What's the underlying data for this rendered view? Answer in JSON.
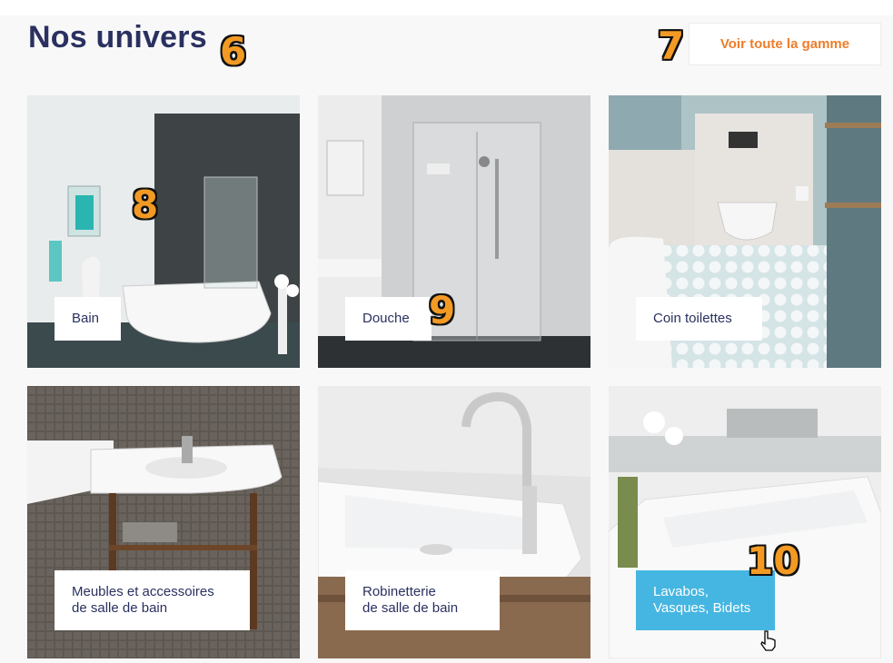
{
  "section": {
    "title": "Nos univers",
    "see_all_label": "Voir toute la gamme"
  },
  "markers": [
    "6",
    "7",
    "8",
    "9",
    "10"
  ],
  "tiles": [
    {
      "label": "Bain"
    },
    {
      "label": "Douche"
    },
    {
      "label": "Coin toilettes"
    },
    {
      "label_line1": "Meubles et accessoires",
      "label_line2": "de salle de bain"
    },
    {
      "label_line1": "Robinetterie",
      "label_line2": "de salle  de bain"
    },
    {
      "label_line1": "Lavabos,",
      "label_line2": "Vasques, Bidets"
    }
  ],
  "colors": {
    "title": "#2a3160",
    "accent_orange": "#ee7d2b",
    "active_label": "#45b6e1",
    "marker": "#f39a24"
  }
}
